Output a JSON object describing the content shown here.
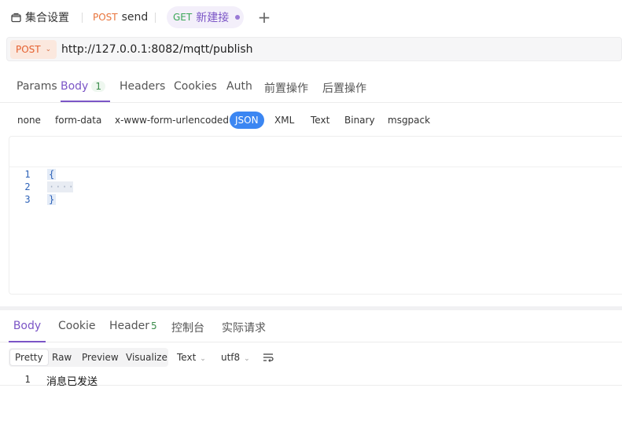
{
  "top_tabs": [
    {
      "icon": "folder-icon",
      "label": "集合设置"
    },
    {
      "method": "POST",
      "label": "send"
    },
    {
      "method": "GET",
      "label": "新建接"
    }
  ],
  "url_bar": {
    "method": "POST",
    "url": "http://127.0.0.1:8082/mqtt/publish"
  },
  "request_tabs": [
    {
      "label": "Params"
    },
    {
      "label": "Body",
      "badge": "1"
    },
    {
      "label": "Headers"
    },
    {
      "label": "Cookies"
    },
    {
      "label": "Auth"
    },
    {
      "label": "前置操作"
    },
    {
      "label": "后置操作"
    }
  ],
  "body_types": [
    "none",
    "form-data",
    "x-www-form-urlencoded",
    "JSON",
    "XML",
    "Text",
    "Binary",
    "msgpack"
  ],
  "editor": {
    "lines": [
      {
        "num": "1",
        "code": "{"
      },
      {
        "num": "2",
        "code": "····"
      },
      {
        "num": "3",
        "code": "}"
      }
    ]
  },
  "response_tabs": [
    {
      "label": "Body"
    },
    {
      "label": "Cookie"
    },
    {
      "label": "Header",
      "badge": "5"
    },
    {
      "label": "控制台"
    },
    {
      "label": "实际请求"
    }
  ],
  "view_options": [
    "Pretty",
    "Raw",
    "Preview",
    "Visualize"
  ],
  "format_select": "Text",
  "encoding_select": "utf8",
  "response": {
    "line_num": "1",
    "text": "消息已发送"
  },
  "colors": {
    "accent": "#7b55c6",
    "post": "#e5602f",
    "get": "#3aa657",
    "json_active": "#3b86f2"
  }
}
